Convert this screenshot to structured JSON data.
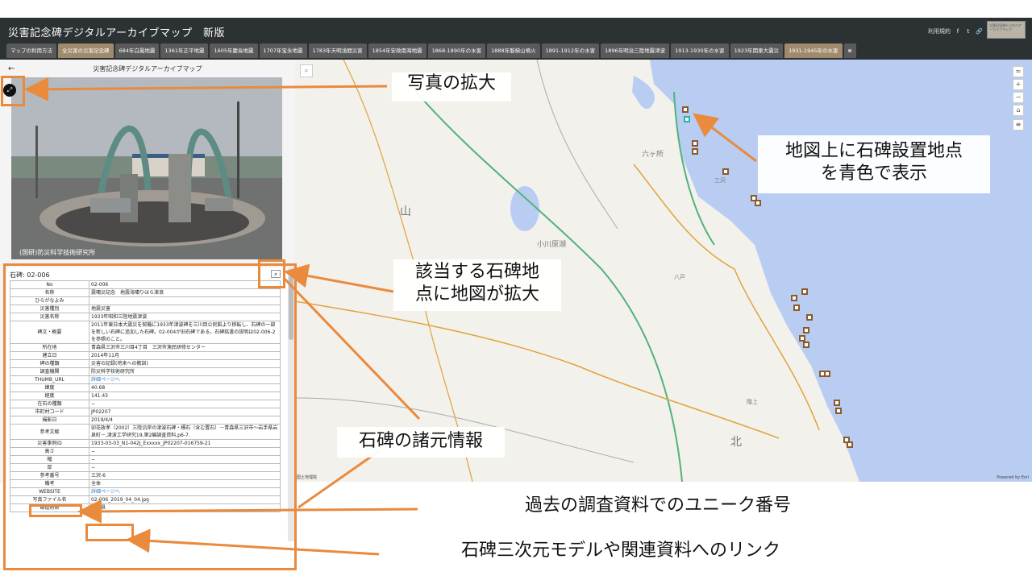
{
  "app": {
    "title": "災害記念碑デジタルアーカイブマップ　新版"
  },
  "header_links": {
    "terms": "利用規約",
    "facebook_icon": "f",
    "twitter_icon": "t",
    "link_icon": "🔗"
  },
  "logo": {
    "text": "災害記念碑デジタルアーカイブマップ"
  },
  "tabs": [
    {
      "label": "マップの利用方法"
    },
    {
      "label": "全災害の災害記念碑"
    },
    {
      "label": "684年白鳳地震"
    },
    {
      "label": "1361年正平地震"
    },
    {
      "label": "1605年慶長地震"
    },
    {
      "label": "1707年宝永地震"
    },
    {
      "label": "1783年天明浅間災害"
    },
    {
      "label": "1854年安政南海地震"
    },
    {
      "label": "1868-1890年の水害"
    },
    {
      "label": "1888年磐梯山噴火"
    },
    {
      "label": "1891-1912年の水害"
    },
    {
      "label": "1896年明治三陸地震津波"
    },
    {
      "label": "1913-1930年の水害"
    },
    {
      "label": "1923年関東大震災"
    },
    {
      "label": "1931-1945年の水害"
    },
    {
      "label": "≣"
    }
  ],
  "panel": {
    "back": "←",
    "title": "災害記念碑デジタルアーカイブマップ",
    "photo_credit": "(国研)防災科学技術研究所",
    "record_title": "石碑: 02-006"
  },
  "attributes": [
    {
      "k": "No",
      "v": "02-006"
    },
    {
      "k": "名称",
      "v": "震嘯災記念　地震海嘯りはら津浪"
    },
    {
      "k": "ひらがなよみ",
      "v": ""
    },
    {
      "k": "災害種別",
      "v": "地震災害"
    },
    {
      "k": "災害名称",
      "v": "1933年昭和三陸地震津波"
    },
    {
      "k": "碑文・概要",
      "v": "2011年東日本大震災を契機に1933年津波碑を三川目公民館より移転し、石碑の一部を新しい石碑に追加した石碑。02-004が旧石碑である。石碑銘書の説明は02-006-2を参照のこと。"
    },
    {
      "k": "所在地",
      "v": "青森県三沢市三川目4丁目　三沢市漁民研修センター"
    },
    {
      "k": "建立日",
      "v": "2014年11月"
    },
    {
      "k": "碑の種類",
      "v": "災害の記録(将来への教訓)"
    },
    {
      "k": "調査機関",
      "v": "防災科学技術研究所"
    },
    {
      "k": "THUMB_URL",
      "v": "詳細ページへ",
      "link": true
    },
    {
      "k": "緯度",
      "v": "40.68"
    },
    {
      "k": "経度",
      "v": "141.43"
    },
    {
      "k": "在石の種類",
      "v": "−"
    },
    {
      "k": "市町村コード",
      "v": "JP02207"
    },
    {
      "k": "撮影日",
      "v": "2019/4/4"
    },
    {
      "k": "参考文献",
      "v": "卯花政孝（2002）三陸沿岸の津波石碑・標石（含む置石）－青森県三沢市～岩手県岩泉町－,津波工学研究19,第2編調査資料,p6-7."
    },
    {
      "k": "災害事例ID",
      "v": "1933-03-03_N1-042J_Exxxxx_JP02207-016759-21"
    },
    {
      "k": "高さ",
      "v": "−"
    },
    {
      "k": "幅",
      "v": "−"
    },
    {
      "k": "厚",
      "v": "−"
    },
    {
      "k": "参考番号",
      "v": "三沢-6"
    },
    {
      "k": "備考",
      "v": "全体"
    },
    {
      "k": "WEBSITE",
      "v": "詳細ページへ",
      "link": true
    },
    {
      "k": "写真ファイル名",
      "v": "02-006_2019_04_04.jpg"
    },
    {
      "k": "都道府県",
      "v": "青森県"
    }
  ],
  "map": {
    "attribution_left": "国土地理院",
    "attribution_right": "Powered by Esri",
    "search_icon": "⌕",
    "controls": [
      "≈",
      "+",
      "−",
      "⌂",
      "≡"
    ],
    "labels": [
      "六ヶ所",
      "小川原湖",
      "三沢",
      "八戸",
      "階上",
      "北",
      "山",
      "地"
    ]
  },
  "callouts": {
    "photo_zoom": "写真の拡大",
    "map_marker": "地図上に石碑設置地点\nを青色で表示",
    "map_zoom": "該当する石碑地\n点に地図が拡大",
    "specs": "石碑の諸元情報",
    "unique_no": "過去の調査資料でのユニーク番号",
    "links": "石碑三次元モデルや関連資料へのリンク"
  },
  "colors": {
    "annotation": "#e98a3d",
    "header": "#2c3134",
    "tab_active": "#a08a6d",
    "sea": "#b9cdf2",
    "marker": "#8a5a2b",
    "marker_selected": "#1fb5a6"
  }
}
